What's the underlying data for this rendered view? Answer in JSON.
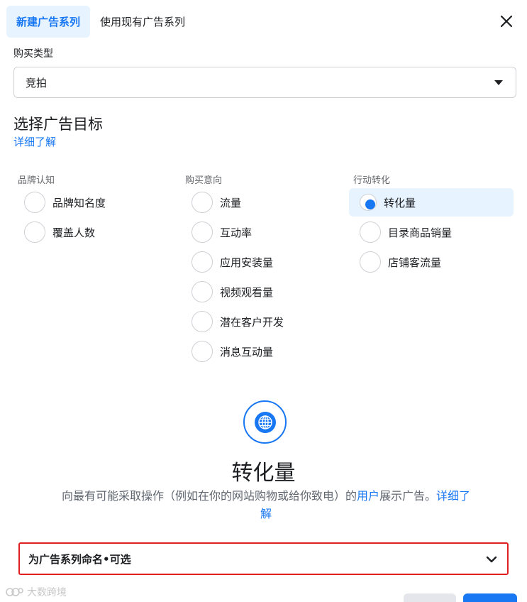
{
  "tabs": [
    {
      "label": "新建广告系列",
      "active": true
    },
    {
      "label": "使用现有广告系列",
      "active": false
    }
  ],
  "buying_type": {
    "label": "购买类型",
    "value": "竞拍"
  },
  "objective": {
    "title": "选择广告目标",
    "learn_more": "详细了解",
    "columns": [
      {
        "header": "品牌认知",
        "options": [
          "品牌知名度",
          "覆盖人数"
        ]
      },
      {
        "header": "购买意向",
        "options": [
          "流量",
          "互动率",
          "应用安装量",
          "视频观看量",
          "潜在客户开发",
          "消息互动量"
        ]
      },
      {
        "header": "行动转化",
        "options": [
          "转化量",
          "目录商品销量",
          "店铺客流量"
        ]
      }
    ],
    "selected": "转化量"
  },
  "detail": {
    "icon": "globe-icon",
    "title": "转化量",
    "desc_before": "向最有可能采取操作（例如在你的网站购物或给你致电）的",
    "desc_link_user": "用户",
    "desc_after": "展示广告。",
    "desc_learn_more": "详细了解"
  },
  "campaign_name": {
    "label": "为广告系列命名•可选"
  },
  "watermark": "大数跨境",
  "colors": {
    "accent": "#1877f2",
    "selected_bg": "#e7f3ff",
    "highlight_border": "#e02020"
  }
}
